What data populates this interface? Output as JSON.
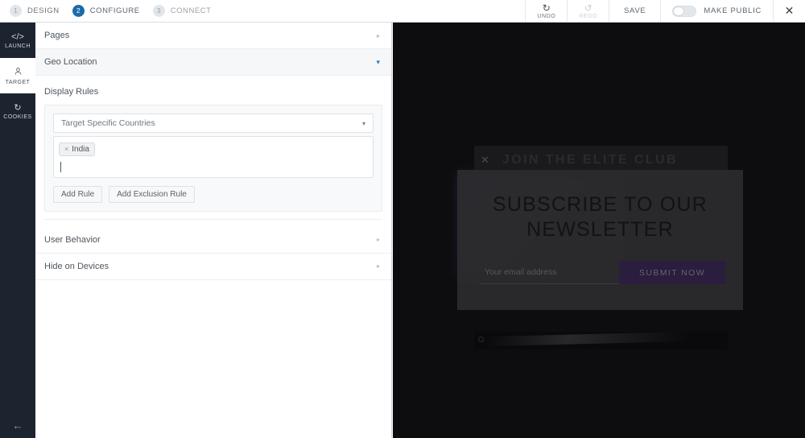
{
  "topbar": {
    "steps": [
      {
        "num": "1",
        "label": "DESIGN",
        "state": "done"
      },
      {
        "num": "2",
        "label": "CONFIGURE",
        "state": "active"
      },
      {
        "num": "3",
        "label": "CONNECT",
        "state": "todo"
      }
    ],
    "undo_label": "UNDO",
    "undo_icon": "undo-icon",
    "redo_label": "REDO",
    "redo_icon": "redo-icon",
    "save_label": "SAVE",
    "make_public_label": "MAKE PUBLIC",
    "make_public_on": false,
    "close_icon": "✕",
    "accent_color": "#1b6ca8"
  },
  "rail": {
    "items": [
      {
        "icon": "‹›",
        "label": "LAUNCH",
        "name": "code-icon",
        "active": false
      },
      {
        "icon": "♟",
        "label": "TARGET",
        "name": "person-icon",
        "active": true
      },
      {
        "icon": "↺",
        "label": "COOKIES",
        "name": "refresh-icon",
        "active": false
      }
    ],
    "back_icon": "←"
  },
  "panel": {
    "rows_top": [
      {
        "label": "Pages",
        "arrow": "▸",
        "open": false,
        "shaded": false
      },
      {
        "label": "Geo Location",
        "arrow": "▾",
        "open": true,
        "shaded": true
      }
    ],
    "display_rules_label": "Display Rules",
    "rule_select_value": "Target Specific Countries",
    "rule_select_caret": "▾",
    "tokens": [
      {
        "remove": "×",
        "label": "India"
      }
    ],
    "add_rule_label": "Add Rule",
    "add_exclusion_label": "Add Exclusion Rule",
    "rows_bottom": [
      {
        "label": "User Behavior",
        "arrow": "▸",
        "open": false,
        "shaded": false
      },
      {
        "label": "Hide on Devices",
        "arrow": "▸",
        "open": false,
        "shaded": false
      }
    ]
  },
  "preview": {
    "site_bar_title": "JOIN THE ELITE CLUB",
    "site_bar_close": "✕",
    "popup": {
      "title": "SUBSCRIBE TO OUR NEWSLETTER",
      "email_placeholder": "Your email address",
      "email_value": "",
      "submit_label": "SUBMIT NOW",
      "submit_color": "#2a1d3d"
    }
  }
}
